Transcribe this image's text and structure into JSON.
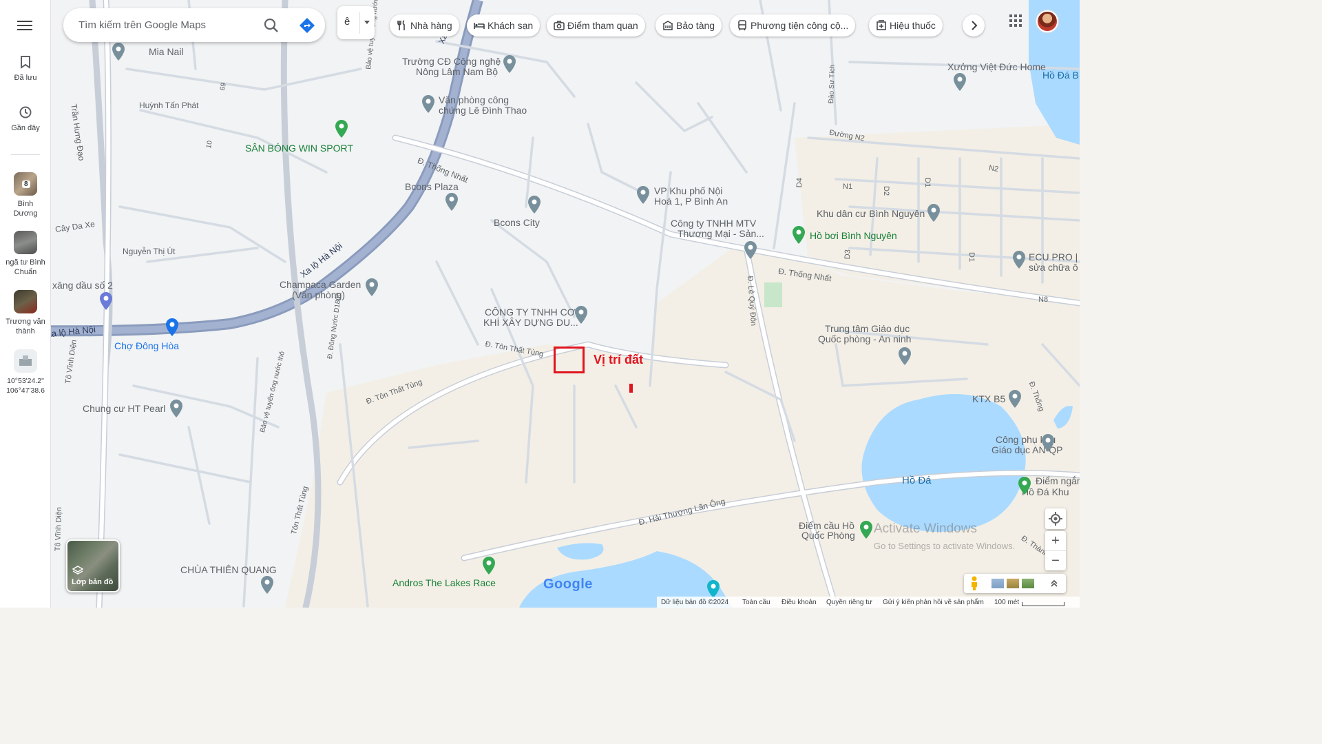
{
  "sidebar": {
    "saved_label": "Đã lưu",
    "recent_label": "Gần đây",
    "history": [
      {
        "label": "Bình Dương",
        "badge": "8"
      },
      {
        "label": "ngã tư Bình Chuẩn"
      },
      {
        "label": "Trương văn thành"
      },
      {
        "label": "10°53'24.2\" 106°47'38.6"
      }
    ]
  },
  "search": {
    "placeholder": "Tìm kiếm trên Google Maps",
    "lang_label": "ê"
  },
  "chips": [
    {
      "label": "Nhà hàng",
      "icon": "restaurant-icon"
    },
    {
      "label": "Khách sạn",
      "icon": "hotel-icon"
    },
    {
      "label": "Điểm tham quan",
      "icon": "camera-icon"
    },
    {
      "label": "Bảo tàng",
      "icon": "museum-icon"
    },
    {
      "label": "Phương tiện công cộ...",
      "icon": "transit-icon"
    },
    {
      "label": "Hiệu thuốc",
      "icon": "pharmacy-icon"
    }
  ],
  "map": {
    "annotation_label": "Vị trí đất",
    "places": [
      "Mia Nail",
      "Trường CĐ Công nghệ",
      "Nông Lâm Nam Bộ",
      "Văn phòng công",
      "chứng Lê Đình Thao",
      "SÂN BÓNG WIN SPORT",
      "Bcons Plaza",
      "Bcons City",
      "VP Khu phố Nội",
      "Hoá 1, P Bình An",
      "Công ty TNHH MTV",
      "Thương Mại - Sản...",
      "Khu dân cư Bình Nguyên",
      "Hồ bơi Bình Nguyên",
      "ECU PRO |",
      "sửa chữa ô",
      "Xưởng Việt Đức Home",
      "Hồ Đá B",
      "Champaca Garden",
      "(Văn phòng)",
      "xăng dầu số 2",
      "Chợ Đông Hòa",
      "CÔNG TY TNHH CƠ",
      "KHÍ XÂY DỰNG DU...",
      "Trung tâm Giáo dục",
      "Quốc phòng - An ninh",
      "Chung cư HT Pearl",
      "KTX B5",
      "Công phụ khu",
      "Giáo dục AN-QP",
      "Hồ Đá",
      "Điểm cầu Hồ",
      "Quốc Phòng",
      "Điểm ngắm",
      "Hồ Đá Khu",
      "CHÙA THIÊN QUANG",
      "Andros The Lakes Race"
    ],
    "streets": [
      "Trần Hưng Đạo",
      "Huỳnh Tấn Phát",
      "Cây Da Xe",
      "Nguyễn Thị Út",
      "Xa lộ Hà Nội",
      "Xa lộ Hà Nội",
      "Đ. Thống Nhất",
      "Đ. Thống Nhất",
      "Đ. Tôn Thất Tùng",
      "Đ. Tôn Thất Tùng",
      "Đ. Đông Nước D1800",
      "Bảo vệ tuyến ống nước thô",
      "Bảo vệ tuyến ống nước thô",
      "Tô Vĩnh Diện",
      "Tô Vĩnh Diện",
      "Đ. Lê Quý Đôn",
      "Đào Sư Tích",
      "Đường N2",
      "N2",
      "N1",
      "D4",
      "D2",
      "D1",
      "D1",
      "D3",
      "N8",
      "Đ. Hải Thượng Lãn Ông",
      "Tôn Thất Tùng",
      "Đ. Thống",
      "69",
      "10",
      "Xa lộ",
      "Đ. Thành"
    ]
  },
  "controls": {
    "layers_label": "Lớp bản đồ",
    "zoom_in": "+",
    "zoom_out": "−"
  },
  "watermark": {
    "line1": "Activate Windows",
    "line2": "Go to Settings to activate Windows."
  },
  "google_logo": "Google",
  "footer": {
    "data": "Dữ liệu bản đồ ©2024",
    "global": "Toàn cầu",
    "terms": "Điều khoản",
    "privacy": "Quyền riêng tư",
    "feedback": "Gửi ý kiến phản hồi về sản phẩm",
    "scale": "100 mét"
  },
  "colors": {
    "road": "#ffffff",
    "road_outline": "#c8ced8",
    "highway": "#8a9bbd",
    "water": "#aadaff",
    "land_tan": "#f2efe9",
    "land_urban": "#f1f3f4",
    "park": "#c8e6c9",
    "accent_red": "#e0141e",
    "pin_gray": "#78909c",
    "pin_green": "#34a853",
    "pin_blue": "#1a73e8"
  }
}
